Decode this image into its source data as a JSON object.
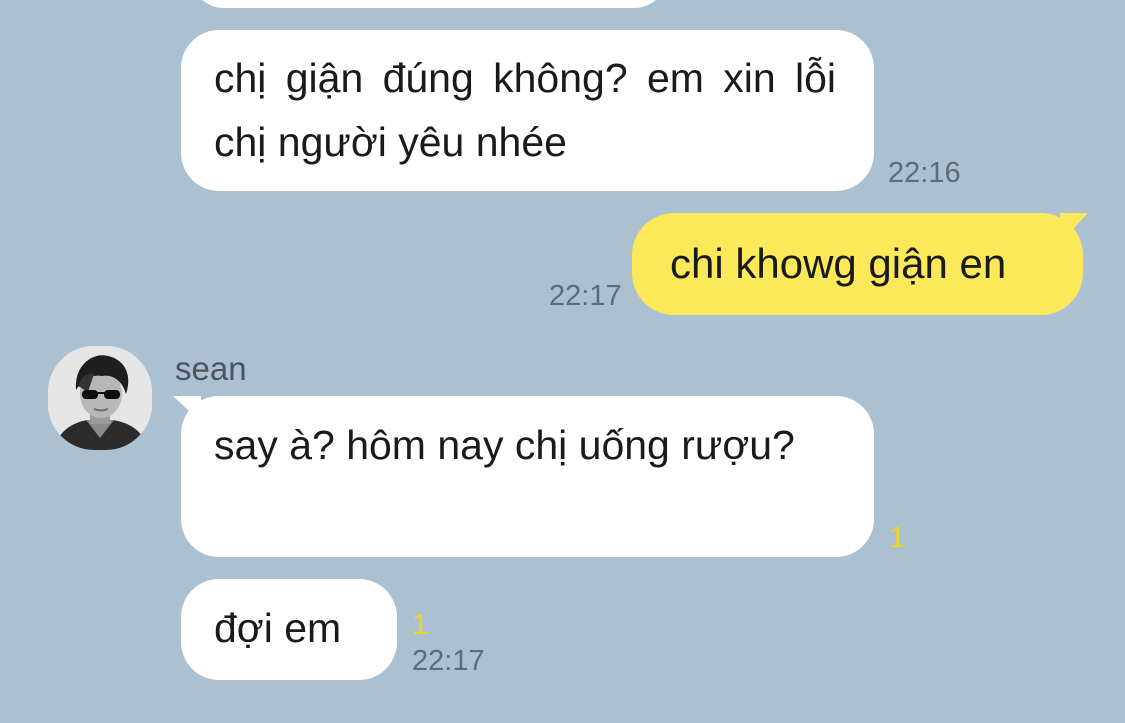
{
  "messages": [
    {
      "direction": "incoming",
      "text": "chị giận đúng không? em xin lỗi chị người yêu nhée",
      "time": "22:16"
    },
    {
      "direction": "outgoing",
      "text": "chi khowg giận en",
      "time": "22:17"
    },
    {
      "direction": "incoming",
      "sender": "sean",
      "text": "say à? hôm nay chị uống rượu?",
      "unread": "1"
    },
    {
      "direction": "incoming",
      "text": "đợi em",
      "unread": "1",
      "time": "22:17"
    }
  ],
  "colors": {
    "background": "#abc1d1",
    "incoming_bubble": "#ffffff",
    "outgoing_bubble": "#fbe959",
    "unread_count": "#f2d41f",
    "timestamp": "#5f6b75"
  },
  "icons": {
    "avatar": "user-avatar-photo"
  }
}
